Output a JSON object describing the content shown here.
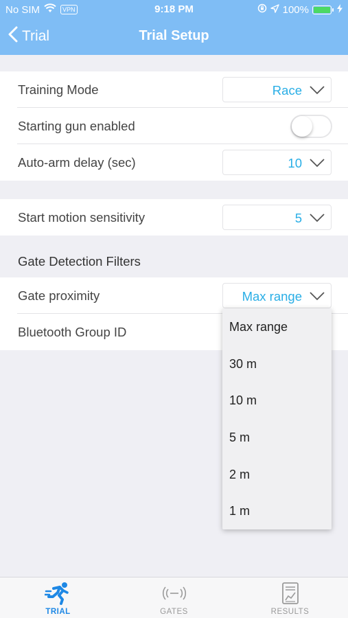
{
  "status_bar": {
    "carrier": "No SIM",
    "vpn": "VPN",
    "time": "9:18 PM",
    "battery": "100%",
    "icons": [
      "wifi-icon",
      "lock-rotation-icon",
      "location-arrow-icon",
      "battery-icon",
      "charging-bolt-icon"
    ]
  },
  "nav": {
    "back_label": "Trial",
    "title": "Trial Setup"
  },
  "settings": {
    "training_mode": {
      "label": "Training Mode",
      "value": "Race"
    },
    "starting_gun": {
      "label": "Starting gun enabled",
      "enabled": false
    },
    "auto_arm": {
      "label": "Auto-arm delay (sec)",
      "value": "10"
    },
    "sensitivity": {
      "label": "Start motion sensitivity",
      "value": "5"
    },
    "section_header": "Gate Detection Filters",
    "gate_proximity": {
      "label": "Gate proximity",
      "value": "Max range"
    },
    "bluetooth": {
      "label": "Bluetooth Group ID"
    }
  },
  "dropdown": {
    "options": [
      "Max range",
      "30 m",
      "10 m",
      "5 m",
      "2 m",
      "1 m"
    ]
  },
  "tabs": [
    {
      "label": "TRIAL",
      "icon": "runner-icon",
      "active": true
    },
    {
      "label": "GATES",
      "icon": "signal-waves-icon",
      "active": false
    },
    {
      "label": "RESULTS",
      "icon": "results-report-icon",
      "active": false
    }
  ],
  "colors": {
    "header": "#7fbdf5",
    "accent": "#29aee6",
    "active_tab": "#1e88e5",
    "background": "#efeff4"
  }
}
